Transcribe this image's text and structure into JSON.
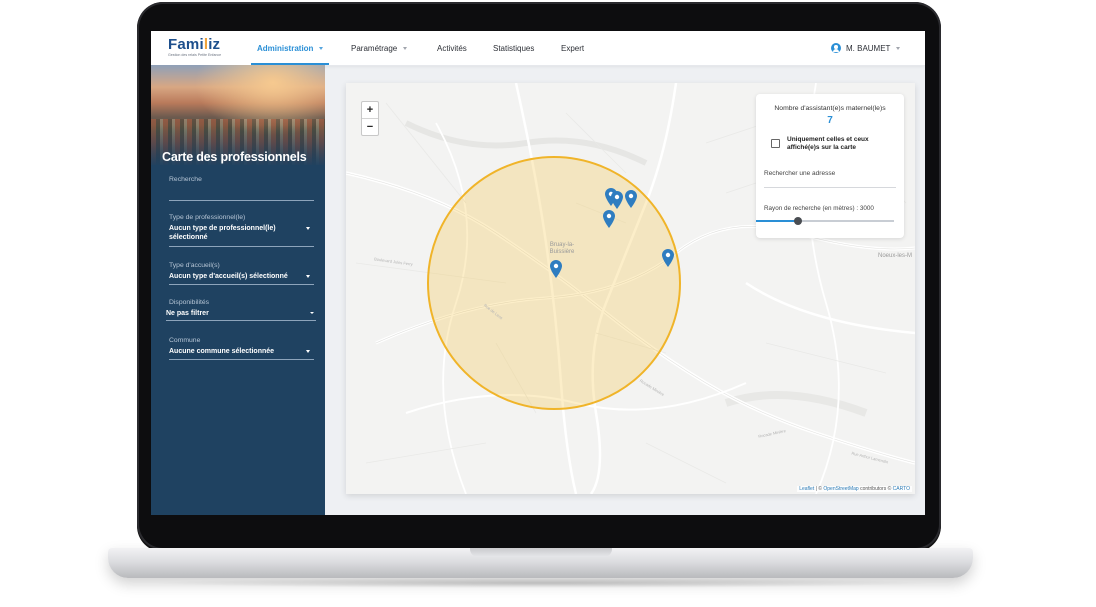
{
  "app": {
    "logo": {
      "word_start": "Fami",
      "word_accent": "l",
      "word_end": "iz",
      "tagline": "Gestion des relais Petite Enfance"
    }
  },
  "topnav": {
    "items": [
      {
        "label": "Administration",
        "active": true,
        "has_caret": true
      },
      {
        "label": "Paramétrage",
        "active": false,
        "has_caret": true
      },
      {
        "label": "Activités",
        "active": false,
        "has_caret": false
      },
      {
        "label": "Statistiques",
        "active": false,
        "has_caret": false
      },
      {
        "label": "Expert",
        "active": false,
        "has_caret": false
      }
    ],
    "user": {
      "name": "M. BAUMET",
      "icon": "user-circle-icon"
    }
  },
  "sidebar": {
    "title": "Carte des professionnels",
    "fields": {
      "search": {
        "label": "Recherche",
        "value": ""
      },
      "type_pro": {
        "label": "Type de professionnel(le)",
        "value": "Aucun type de professionnel(le) sélectionné"
      },
      "type_accueil": {
        "label": "Type d'accueil(s)",
        "value": "Aucun type d'accueil(s) sélectionné"
      },
      "disponibilites": {
        "label": "Disponibilités",
        "value": "Ne pas filtrer"
      },
      "commune": {
        "label": "Commune",
        "value": "Aucune commune sélectionnée"
      }
    }
  },
  "map": {
    "zoom_in": "+",
    "zoom_out": "−",
    "place_label": "Bruay-la-Buissière",
    "edge_label": "Noeux-les-M",
    "road_labels": [
      "Boulevard Jules Ferry",
      "Rue de Lens",
      "Rocade Minière",
      "Rocade Minière",
      "Rue Arthur Lamendin"
    ],
    "attribution": {
      "leaflet": "Leaflet",
      "sep1": " | © ",
      "osm": "OpenStreetMap",
      "contrib": " contributors © ",
      "carto": "CARTO"
    },
    "circle_color": "#f6c84c",
    "marker_color": "#2f7dc0",
    "marker_count": 6
  },
  "panel": {
    "count_label": "Nombre d'assistant(e)s maternel(le)s",
    "count": "7",
    "checkbox_label": "Uniquement celles et ceux affiché(e)s sur la carte",
    "checkbox_checked": false,
    "address_placeholder": "Rechercher une adresse",
    "radius_label": "Rayon de recherche (en mètres) : 3000",
    "radius_value": 3000
  }
}
